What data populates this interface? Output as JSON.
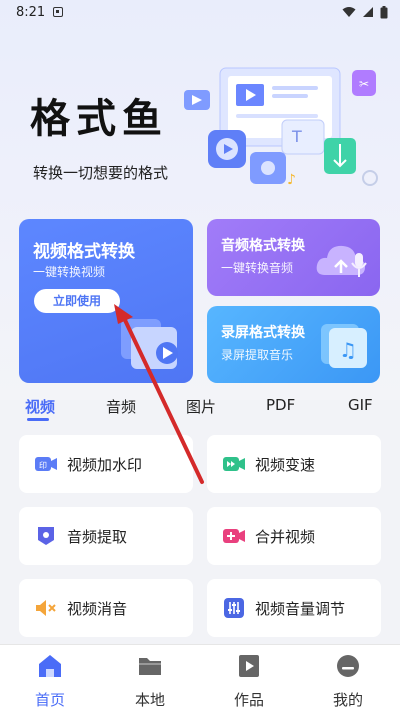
{
  "status_bar": {
    "time": "8:21"
  },
  "hero": {
    "title": "格式鱼",
    "subtitle": "转换一切想要的格式"
  },
  "cards": {
    "video": {
      "title": "视频格式转换",
      "subtitle": "一键转换视频",
      "button": "立即使用"
    },
    "audio": {
      "title": "音频格式转换",
      "subtitle": "一键转换音频"
    },
    "screen": {
      "title": "录屏格式转换",
      "subtitle": "录屏提取音乐"
    }
  },
  "tabs": [
    "视频",
    "音频",
    "图片",
    "PDF",
    "GIF"
  ],
  "active_tab": "视频",
  "tools": [
    {
      "label": "视频加水印",
      "icon": "video-watermark-icon"
    },
    {
      "label": "视频变速",
      "icon": "video-speed-icon"
    },
    {
      "label": "音频提取",
      "icon": "audio-extract-icon"
    },
    {
      "label": "合并视频",
      "icon": "merge-video-icon"
    },
    {
      "label": "视频消音",
      "icon": "mute-video-icon"
    },
    {
      "label": "视频音量调节",
      "icon": "volume-adjust-icon"
    }
  ],
  "bottom_nav": [
    {
      "label": "首页",
      "icon": "home-icon"
    },
    {
      "label": "本地",
      "icon": "folder-icon"
    },
    {
      "label": "作品",
      "icon": "play-file-icon"
    },
    {
      "label": "我的",
      "icon": "profile-icon"
    }
  ],
  "active_nav": "首页",
  "colors": {
    "accent": "#4a6cf7",
    "video_card": "#5d87ff",
    "audio_card": "#9370f5",
    "screen_card": "#4aa8fa",
    "annotation_arrow": "#d42a2a"
  }
}
